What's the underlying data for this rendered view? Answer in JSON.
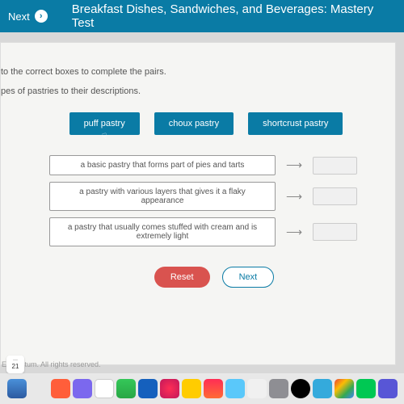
{
  "header": {
    "next_label": "Next",
    "title": "Breakfast Dishes, Sandwiches, and Beverages: Mastery Test"
  },
  "content": {
    "instr1": "to the correct boxes to complete the pairs.",
    "instr2": "pes of pastries to their descriptions.",
    "chips": {
      "puff": "puff pastry",
      "choux": "choux pastry",
      "shortcrust": "shortcrust pastry"
    },
    "descriptions": {
      "d1": "a basic pastry that forms part of pies and tarts",
      "d2": "a pastry with various layers that gives it a flaky appearance",
      "d3": "a pastry that usually comes stuffed with cream and is extremely light"
    },
    "buttons": {
      "reset": "Reset",
      "next": "Next"
    }
  },
  "footer": {
    "copyright": "Edmentum. All rights reserved."
  },
  "dock": {
    "date": "21"
  }
}
